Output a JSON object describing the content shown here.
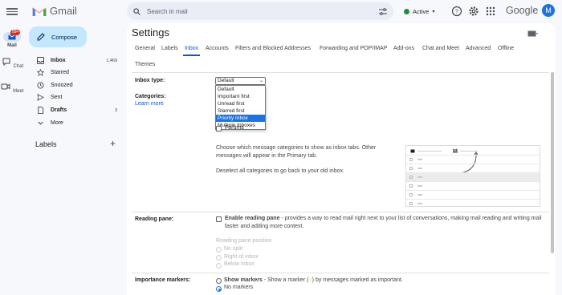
{
  "header": {
    "brand": "Gmail",
    "search_placeholder": "Search in mail",
    "status": "Active",
    "google_word": "Google",
    "avatar_letter": "M"
  },
  "rail": {
    "mail_label": "Mail",
    "mail_badge": "99+",
    "chat_label": "Chat",
    "meet_label": "Meet"
  },
  "sidebar": {
    "compose_label": "Compose",
    "items": [
      {
        "label": "Inbox",
        "count": "1,469",
        "icon": "inbox-icon"
      },
      {
        "label": "Starred",
        "count": "",
        "icon": "star-icon"
      },
      {
        "label": "Snoozed",
        "count": "",
        "icon": "clock-icon"
      },
      {
        "label": "Sent",
        "count": "",
        "icon": "send-icon"
      },
      {
        "label": "Drafts",
        "count": "3",
        "icon": "draft-icon"
      },
      {
        "label": "More",
        "count": "",
        "icon": "chevron-down-icon"
      }
    ],
    "labels_heading": "Labels"
  },
  "settings": {
    "title": "Settings",
    "tabs": [
      "General",
      "Labels",
      "Inbox",
      "Accounts",
      "Filters and Blocked Addresses",
      "Forwarding and POP/IMAP",
      "Add-ons",
      "Chat and Meet",
      "Advanced",
      "Offline",
      "Themes"
    ],
    "active_tab": "Inbox",
    "inbox_type": {
      "label": "Inbox type:",
      "selected": "Default",
      "options": [
        "Default",
        "Important first",
        "Unread first",
        "Starred first",
        "Priority Inbox",
        "Multiple Inboxes"
      ],
      "highlighted": "Priority Inbox"
    },
    "categories": {
      "label": "Categories:",
      "learn_more": "Learn more",
      "forums": "Forums",
      "desc1": "Choose which message categories to show as inbox tabs. Other",
      "desc2": "messages will appear in the Primary tab.",
      "desc3": "Deselect all categories to go back to your old inbox."
    },
    "reading_pane": {
      "label": "Reading pane:",
      "enable_bold": "Enable reading pane",
      "enable_rest": " - provides a way to read mail right next to your list of conversations, making mail reading and writing mail",
      "enable_line2": "faster and adding more context.",
      "position_label": "Reading pane position",
      "options": [
        "No split",
        "Right of inbox",
        "Below inbox"
      ]
    },
    "importance": {
      "label": "Importance markers:",
      "show_bold": "Show markers",
      "show_rest": " - Show a marker (",
      "show_rest2": ") by messages marked as important.",
      "no_markers": "No markers"
    }
  },
  "colors": {
    "accent": "#0b57d0",
    "compose_bg": "#c2e7ff",
    "status_green": "#1e8e3e",
    "badge_red": "#d93025"
  }
}
